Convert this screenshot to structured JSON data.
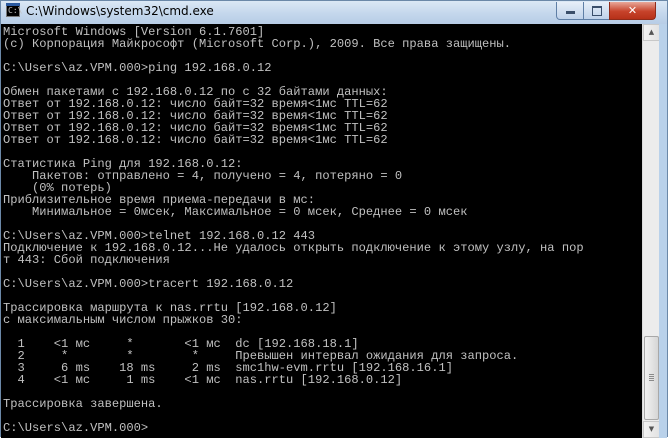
{
  "window": {
    "title": "C:\\Windows\\system32\\cmd.exe",
    "icon_text": "C:\\",
    "controls": {
      "minimize": "minimize",
      "maximize": "maximize",
      "close": "✕"
    }
  },
  "console": {
    "lines": [
      "Microsoft Windows [Version 6.1.7601]",
      "(c) Корпорация Майкрософт (Microsoft Corp.), 2009. Все права защищены.",
      "",
      "C:\\Users\\az.VPM.000>ping 192.168.0.12",
      "",
      "Обмен пакетами с 192.168.0.12 по с 32 байтами данных:",
      "Ответ от 192.168.0.12: число байт=32 время<1мс TTL=62",
      "Ответ от 192.168.0.12: число байт=32 время<1мс TTL=62",
      "Ответ от 192.168.0.12: число байт=32 время<1мс TTL=62",
      "Ответ от 192.168.0.12: число байт=32 время<1мс TTL=62",
      "",
      "Статистика Ping для 192.168.0.12:",
      "    Пакетов: отправлено = 4, получено = 4, потеряно = 0",
      "    (0% потерь)",
      "Приблизительное время приема-передачи в мс:",
      "    Минимальное = 0мсек, Максимальное = 0 мсек, Среднее = 0 мсек",
      "",
      "C:\\Users\\az.VPM.000>telnet 192.168.0.12 443",
      "Подключение к 192.168.0.12...Не удалось открыть подключение к этому узлу, на пор",
      "т 443: Сбой подключения",
      "",
      "C:\\Users\\az.VPM.000>tracert 192.168.0.12",
      "",
      "Трассировка маршрута к nas.rrtu [192.168.0.12]",
      "с максимальным числом прыжков 30:",
      "",
      "  1    <1 мс     *       <1 мс  dc [192.168.18.1]",
      "  2     *        *        *     Превышен интервал ожидания для запроса.",
      "  3     6 ms    18 ms     2 ms  smc1hw-evm.rrtu [192.168.16.1]",
      "  4    <1 мс     1 ms    <1 мс  nas.rrtu [192.168.0.12]",
      "",
      "Трассировка завершена.",
      "",
      "C:\\Users\\az.VPM.000>"
    ],
    "text_color": "#c0c0c0",
    "background_color": "#000000"
  },
  "scrollbar": {
    "up_arrow": "▲",
    "down_arrow": "▼"
  }
}
